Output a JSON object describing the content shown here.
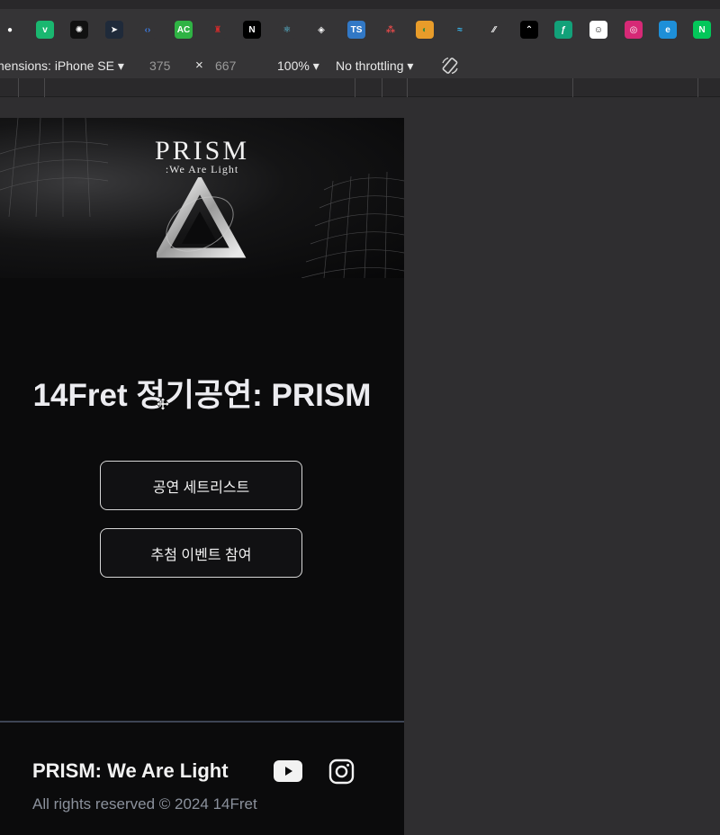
{
  "bookmarks": [
    {
      "name": "github-icon",
      "glyph": "●",
      "bg": "#353436",
      "color": "#ffffff"
    },
    {
      "name": "vimeo-icon",
      "glyph": "v",
      "bg": "#1ab770",
      "color": "#ffffff"
    },
    {
      "name": "openai-icon",
      "glyph": "✺",
      "bg": "#111111",
      "color": "#ffffff"
    },
    {
      "name": "bird-icon",
      "glyph": "➤",
      "bg": "#1f2a3a",
      "color": "#ffffff"
    },
    {
      "name": "code-icon",
      "glyph": "‹›",
      "bg": "#353436",
      "color": "#3d7be0"
    },
    {
      "name": "ac-icon",
      "glyph": "AC",
      "bg": "#2fb344",
      "color": "#ffffff"
    },
    {
      "name": "tower-icon",
      "glyph": "♜",
      "bg": "#353436",
      "color": "#d42b2b"
    },
    {
      "name": "nextjs-icon",
      "glyph": "N",
      "bg": "#000000",
      "color": "#ffffff"
    },
    {
      "name": "react-icon",
      "glyph": "⚛",
      "bg": "#353436",
      "color": "#61dafb"
    },
    {
      "name": "cube-icon",
      "glyph": "◈",
      "bg": "#353436",
      "color": "#ffffff"
    },
    {
      "name": "typescript-icon",
      "glyph": "TS",
      "bg": "#3178c6",
      "color": "#ffffff"
    },
    {
      "name": "dots-icon",
      "glyph": "⁂",
      "bg": "#353436",
      "color": "#e24a4a"
    },
    {
      "name": "globe-icon",
      "glyph": "◐",
      "bg": "#e89c2a",
      "color": "#3b8a3b"
    },
    {
      "name": "tailwind-icon",
      "glyph": "≈",
      "bg": "#353436",
      "color": "#38bdf8"
    },
    {
      "name": "slash-icon",
      "glyph": "⁄⁄",
      "bg": "#353436",
      "color": "#ffffff"
    },
    {
      "name": "chevrons-up-icon",
      "glyph": "⌃",
      "bg": "#000000",
      "color": "#ffffff"
    },
    {
      "name": "feather-icon",
      "glyph": "ƒ",
      "bg": "#12a179",
      "color": "#ffffff"
    },
    {
      "name": "smile-icon",
      "glyph": "☺",
      "bg": "#ffffff",
      "color": "#111111"
    },
    {
      "name": "instagram-bookmark-icon",
      "glyph": "◎",
      "bg": "#d62976",
      "color": "#ffffff"
    },
    {
      "name": "edge-icon",
      "glyph": "e",
      "bg": "#1e8fd8",
      "color": "#ffffff"
    },
    {
      "name": "naver-icon",
      "glyph": "N",
      "bg": "#03c75a",
      "color": "#ffffff"
    }
  ],
  "device_toolbar": {
    "dimensions_label": "nensions: iPhone SE",
    "width": "375",
    "times": "×",
    "height": "667",
    "zoom": "100%",
    "throttling": "No throttling",
    "caret": "▾"
  },
  "page": {
    "hero_title": "PRISM",
    "hero_subtitle": ":We Are Light",
    "title": "14Fret 정기공연: PRISM",
    "buttons": {
      "setlist": "공연 세트리스트",
      "event": "추첨 이벤트 참여"
    },
    "footer": {
      "title": "PRISM: We Are Light",
      "copyright": "All rights reserved © 2024 14Fret"
    }
  }
}
